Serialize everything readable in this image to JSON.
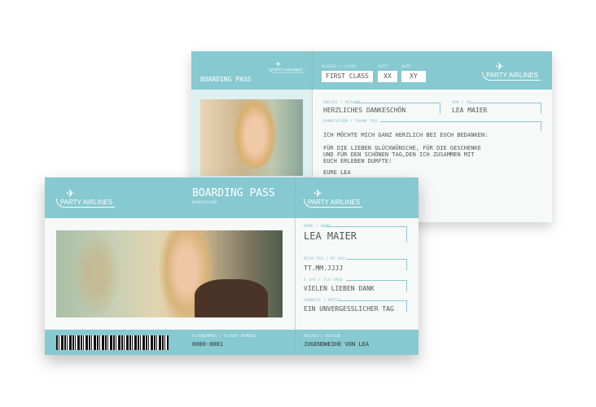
{
  "back_card": {
    "title": "BOARDING PASS",
    "logo": "PARTY AIRLINES",
    "class_label": "KLASSE / CLASS",
    "class_value": "FIRST CLASS",
    "seat_label": "SEAT",
    "seat_value": "XX",
    "gate_label": "GATE",
    "gate_value": "XY",
    "reason_label": "ANLASS / REASON",
    "reason_value": "HERZLICHES DANKESCHÖN",
    "from_label": "VON / OF",
    "from_value": "LEA MAIER",
    "thanks_label": "DANKESCHÖN / THANK YOU",
    "message_line1": "ICH MÖCHTE MICH GANZ HERZLICH BEI EUCH BEDANKEN:",
    "message_line2": "FÜR DIE LIEBEN GLÜCKWÜNSCHE, FÜR DIE GESCHENKE",
    "message_line3": "UND FÜR DEN SCHÖNEN TAG,DEN ICH ZUSAMMEN MIT",
    "message_line4": "EUCH ERLEBEN DURFTE!",
    "message_line5": "EURE LEA"
  },
  "front_card": {
    "logo": "PARTY AIRLINES",
    "title": "BOARDING PASS",
    "subtitle": "DANKESCHÖN",
    "name_label": "NAME / NAME",
    "name_value": "LEA MAIER",
    "day_label": "MEIN TAG / MY DAY",
    "day_value": "TT.MM.JJJJ",
    "say_label": "I SAY / ICH SAGE",
    "say_value": "VIELEN LIEBEN DANK",
    "notes_label": "HINWEIS | NOTES",
    "notes_value": "EIN UNVERGESSLICHER TAG",
    "flight_label": "FLUGNUMMER / FLIGHT NUMBER",
    "flight_value": "0000-0001",
    "reason_label": "ANLASS / REASON",
    "reason_value": "JUGENDWEIHE VON LEA"
  },
  "colors": {
    "accent": "#87c9d0"
  }
}
